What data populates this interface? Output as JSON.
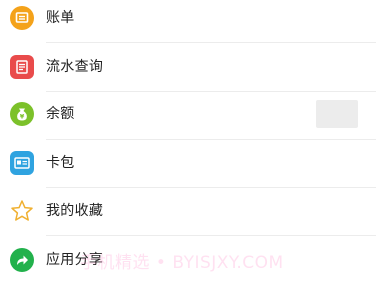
{
  "menu": {
    "items": [
      {
        "label": "账单",
        "icon": "bill-icon",
        "color": "#F4A21A"
      },
      {
        "label": "流水查询",
        "icon": "transaction-query-icon",
        "color": "#E94B4B"
      },
      {
        "label": "余额",
        "icon": "balance-icon",
        "color": "#7CC12A"
      },
      {
        "label": "卡包",
        "icon": "card-wallet-icon",
        "color": "#2FA3E0"
      },
      {
        "label": "我的收藏",
        "icon": "star-icon",
        "color": "#F0B030"
      },
      {
        "label": "应用分享",
        "icon": "share-icon",
        "color": "#22B14C"
      }
    ]
  },
  "watermark": {
    "text": "手机精选 • BYISJXY.COM"
  }
}
